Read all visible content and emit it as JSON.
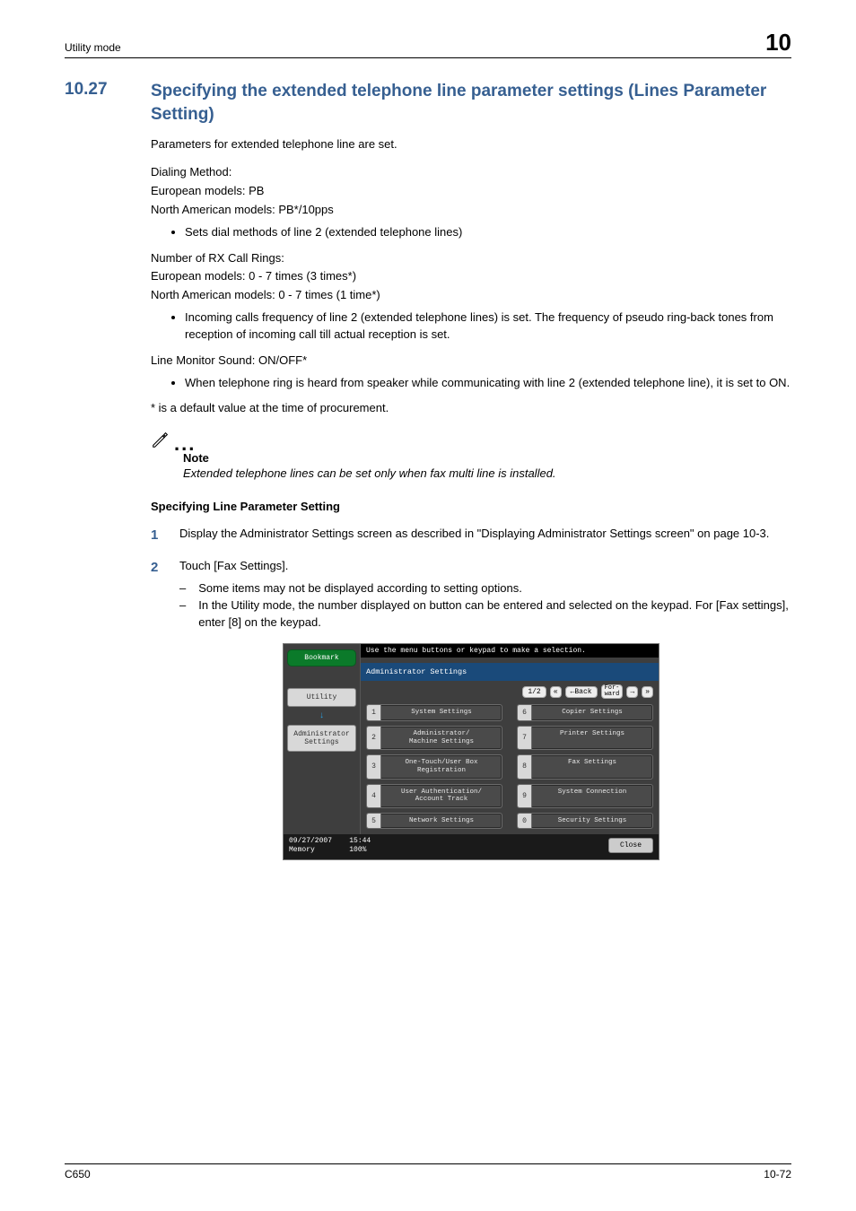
{
  "header": {
    "left": "Utility mode",
    "chapter": "10"
  },
  "section": {
    "number": "10.27",
    "title": "Specifying the extended telephone line parameter settings (Lines Parameter Setting)"
  },
  "body": {
    "intro": "Parameters for extended telephone line are set.",
    "dial_heading": "Dialing Method:",
    "dial_eu": "European models: PB",
    "dial_na": "North American models: PB*/10pps",
    "dial_bullet": "Sets dial methods of line 2 (extended telephone lines)",
    "rx_heading": "Number of RX Call Rings:",
    "rx_eu": "European models: 0 - 7 times (3 times*)",
    "rx_na": "North American models: 0 - 7 times (1 time*)",
    "rx_bullet": "Incoming calls frequency of line 2 (extended telephone lines) is set. The frequency of pseudo ring-back tones from reception of incoming call till actual reception is set.",
    "monitor_heading": "Line Monitor Sound: ON/OFF*",
    "monitor_bullet": "When telephone ring is heard from speaker while communicating with line 2 (extended telephone line), it is set to ON.",
    "default_note": "* is a default value at the time of procurement.",
    "note_label": "Note",
    "note_text": "Extended telephone lines can be set only when fax multi line is installed.",
    "subhead": "Specifying Line Parameter Setting",
    "step1": "Display the Administrator Settings screen as described in \"Displaying Administrator Settings screen\" on page 10-3.",
    "step2_intro": "Touch [Fax Settings].",
    "step2_a": "Some items may not be displayed according to setting options.",
    "step2_b": "In the Utility mode, the number displayed on button can be entered and selected on the keypad. For [Fax settings], enter [8] on the keypad."
  },
  "ui": {
    "instruction": "Use the menu buttons or keypad to make a selection.",
    "panel_title": "Administrator Settings",
    "page_indicator": "1/2",
    "back_label": "←Back",
    "fwd_label": "For-\nward",
    "bookmark": "Bookmark",
    "left_utility": "Utility",
    "left_admin": "Administrator\nSettings",
    "buttons": [
      {
        "n": "1",
        "label": "System Settings"
      },
      {
        "n": "6",
        "label": "Copier Settings"
      },
      {
        "n": "2",
        "label": "Administrator/\nMachine Settings"
      },
      {
        "n": "7",
        "label": "Printer Settings"
      },
      {
        "n": "3",
        "label": "One-Touch/User Box\nRegistration"
      },
      {
        "n": "8",
        "label": "Fax Settings"
      },
      {
        "n": "4",
        "label": "User Authentication/\nAccount Track"
      },
      {
        "n": "9",
        "label": "System Connection"
      },
      {
        "n": "5",
        "label": "Network Settings"
      },
      {
        "n": "0",
        "label": "Security Settings"
      }
    ],
    "footer": {
      "date": "09/27/2007",
      "time": "15:44",
      "mem_label": "Memory",
      "mem_val": "100%",
      "close": "Close"
    }
  },
  "footer": {
    "model": "C650",
    "page": "10-72"
  }
}
